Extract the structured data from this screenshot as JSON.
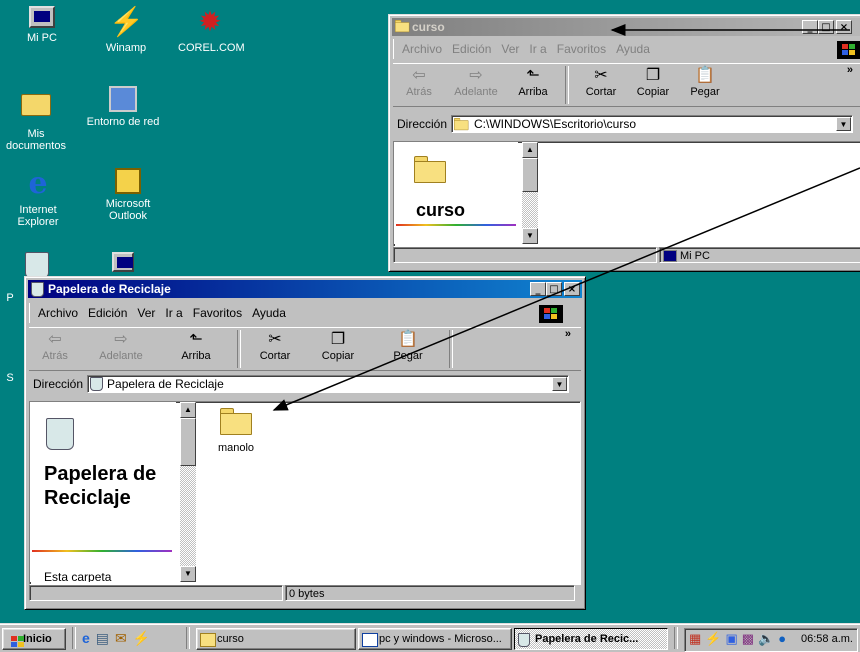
{
  "desktop": {
    "icons": [
      {
        "label": "Mi PC",
        "icon": "computer-icon"
      },
      {
        "label": "Winamp",
        "icon": "winamp-icon"
      },
      {
        "label": "COREL.COM",
        "icon": "corel-icon"
      },
      {
        "label": "Mis documentos",
        "icon": "my-documents-icon"
      },
      {
        "label": "Entorno de red",
        "icon": "network-icon"
      },
      {
        "label": "Internet Explorer",
        "icon": "internet-explorer-icon"
      },
      {
        "label": "Microsoft Outlook",
        "icon": "outlook-icon"
      },
      {
        "label": "P",
        "icon": "recycle-bin-icon"
      },
      {
        "label": "S",
        "icon": "setup-icon"
      }
    ]
  },
  "curso_window": {
    "title": "curso",
    "menu": [
      "Archivo",
      "Edición",
      "Ver",
      "Ir a",
      "Favoritos",
      "Ayuda"
    ],
    "toolbar": [
      "Atrás",
      "Adelante",
      "Arriba",
      "Cortar",
      "Copiar",
      "Pegar"
    ],
    "address_label": "Dirección",
    "address_value": "C:\\WINDOWS\\Escritorio\\curso",
    "panel_title": "curso",
    "status_zone": "Mi PC",
    "chevron": "»"
  },
  "papelera_window": {
    "title": "Papelera de Reciclaje",
    "menu": [
      "Archivo",
      "Edición",
      "Ver",
      "Ir a",
      "Favoritos",
      "Ayuda"
    ],
    "toolbar": [
      "Atrás",
      "Adelante",
      "Arriba",
      "Cortar",
      "Copiar",
      "Pegar"
    ],
    "address_label": "Dirección",
    "address_value": "Papelera de Reciclaje",
    "panel_title": "Papelera de Reciclaje",
    "panel_text": "Esta carpeta",
    "items": [
      {
        "label": "manolo"
      }
    ],
    "status_size": "0 bytes",
    "chevron": "»"
  },
  "taskbar": {
    "start_label": "Inicio",
    "buttons": [
      {
        "label": "curso",
        "active": false
      },
      {
        "label": "pc y windows - Microso...",
        "active": false
      },
      {
        "label": "Papelera de Recic...",
        "active": true
      }
    ],
    "clock": "06:58 a.m."
  },
  "colors": {
    "desktop": "#008080",
    "active_title": "#000080",
    "inactive_title": "#808080",
    "arrows": "#000000"
  }
}
